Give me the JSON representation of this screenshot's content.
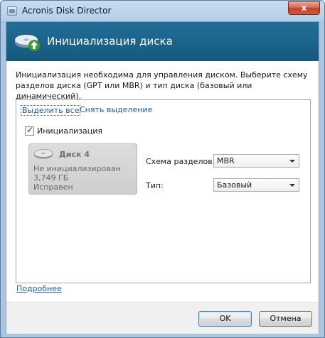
{
  "window": {
    "title": "Acronis Disk Director",
    "close_label": "x"
  },
  "header": {
    "title": "Инициализация диска"
  },
  "description": "Инициализация необходима для управления диском. Выберите схему разделов диска (GPT или MBR) и тип диска (базовый или динамический).",
  "selection": {
    "select_all": "Выделить все",
    "clear_selection": "Снять выделение"
  },
  "init_checkbox": {
    "label": "Инициализация",
    "checked": true
  },
  "disk": {
    "name": "Диск 4",
    "status": "Не инициализирован",
    "size": "3,749 ГБ",
    "health": "Исправен"
  },
  "fields": {
    "scheme_label": "Схема разделов:",
    "scheme_value": "MBR",
    "type_label": "Тип:",
    "type_value": "Базовый"
  },
  "more_link": "Подробнее",
  "buttons": {
    "ok": "OK",
    "cancel": "Отмена"
  },
  "icons": {
    "app": "disk-director-icon",
    "header": "disk-init-icon",
    "disk": "hard-disk-icon"
  }
}
